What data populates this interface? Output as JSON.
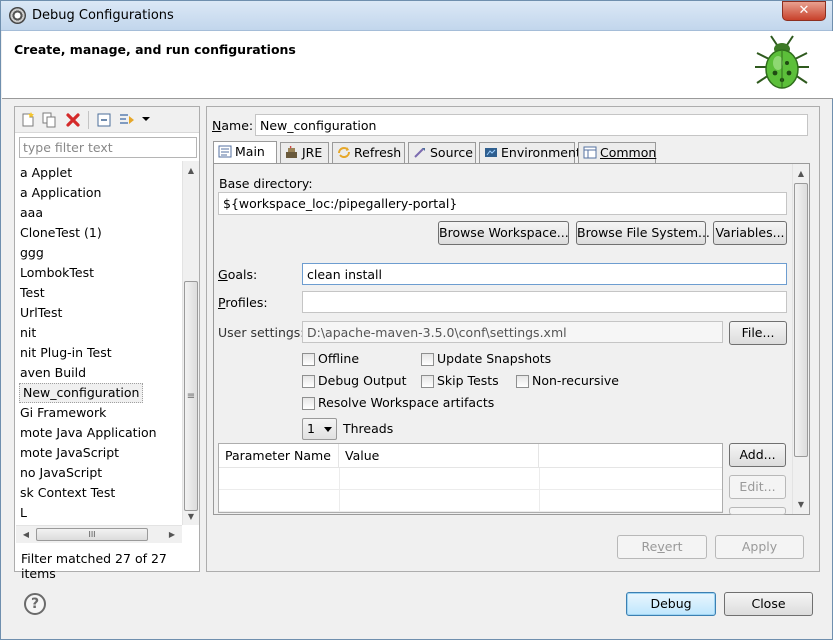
{
  "window": {
    "title": "Debug Configurations",
    "close_glyph": "✕"
  },
  "banner": {
    "title": "Create, manage, and run configurations"
  },
  "left": {
    "filter_placeholder": "type filter text",
    "items": [
      {
        "label": "a Applet"
      },
      {
        "label": "a Application"
      },
      {
        "label": "aaa"
      },
      {
        "label": "CloneTest (1)"
      },
      {
        "label": "ggg"
      },
      {
        "label": "LombokTest"
      },
      {
        "label": "Test"
      },
      {
        "label": "UrlTest"
      },
      {
        "label": "nit"
      },
      {
        "label": "nit Plug-in Test"
      },
      {
        "label": "aven Build"
      },
      {
        "label": "New_configuration",
        "selected": true
      },
      {
        "label": "Gi Framework"
      },
      {
        "label": "mote Java Application"
      },
      {
        "label": "mote JavaScript"
      },
      {
        "label": "no JavaScript"
      },
      {
        "label": "sk Context Test"
      },
      {
        "label": "L"
      }
    ],
    "status": "Filter matched 27 of 27 items",
    "hscroll_grip": "III",
    "vscroll_grip": "≡"
  },
  "main": {
    "name_label": "Name:",
    "name_value": "New_configuration",
    "tabs": [
      {
        "label": "Main",
        "active": true,
        "icon": "main-tab-icon"
      },
      {
        "label": "JRE",
        "icon": "jre-icon"
      },
      {
        "label": "Refresh",
        "icon": "refresh-icon"
      },
      {
        "label": "Source",
        "icon": "source-icon"
      },
      {
        "label": "Environment",
        "icon": "environment-icon"
      },
      {
        "label": "Common",
        "icon": "common-icon"
      }
    ],
    "base_dir_label": "Base directory:",
    "base_dir_value": "${workspace_loc:/pipegallery-portal}",
    "browse_workspace": "Browse Workspace...",
    "browse_fs": "Browse File System...",
    "variables": "Variables...",
    "goals_label": "Goals:",
    "goals_value": "clean install",
    "profiles_label": "Profiles:",
    "profiles_value": "",
    "user_settings_label": "User settings:",
    "user_settings_value": "D:\\apache-maven-3.5.0\\conf\\settings.xml",
    "file_btn": "File...",
    "offline": "Offline",
    "update_snapshots": "Update Snapshots",
    "debug_output": "Debug Output",
    "skip_tests": "Skip Tests",
    "non_recursive": "Non-recursive",
    "resolve_ws": "Resolve Workspace artifacts",
    "threads_value": "1",
    "threads_label": "Threads",
    "param_cols": [
      "Parameter Name",
      "Value"
    ],
    "add_btn": "Add...",
    "edit_btn": "Edit...",
    "revert_btn": "Revert",
    "apply_btn": "Apply"
  },
  "footer": {
    "debug_btn": "Debug",
    "close_btn": "Close",
    "help_glyph": "?"
  },
  "colors": {
    "accent": "#3c7fb1",
    "bug_green": "#5cbf3a",
    "delete_red": "#d42a2a"
  }
}
